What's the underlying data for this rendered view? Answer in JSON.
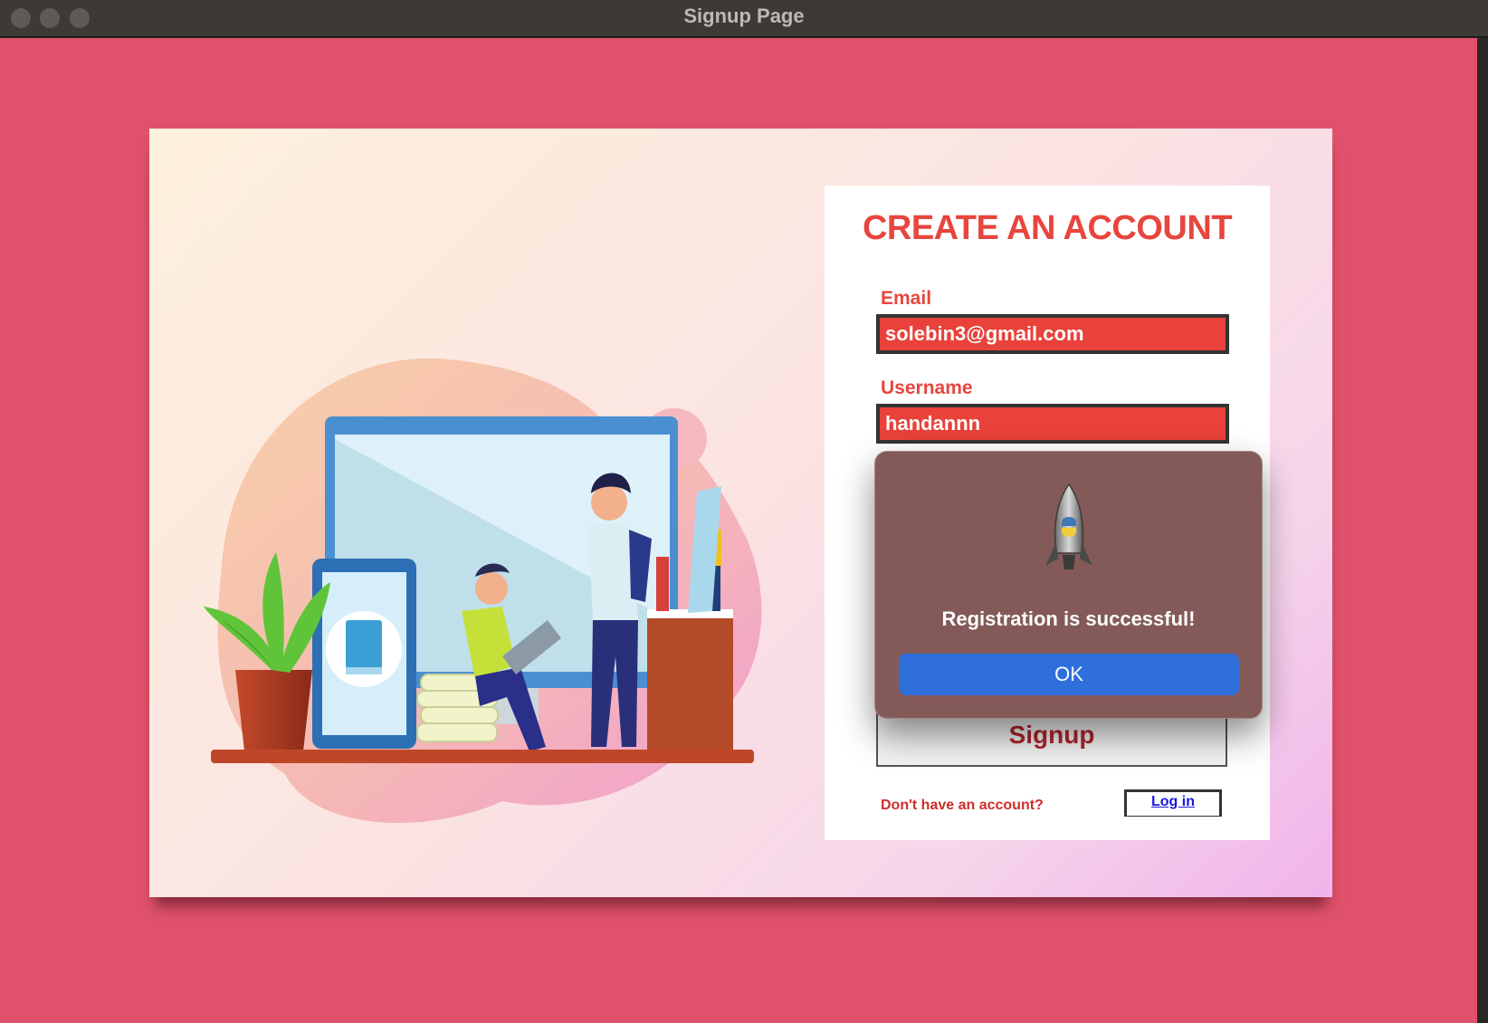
{
  "window": {
    "title": "Signup Page"
  },
  "form": {
    "heading": "CREATE AN ACCOUNT",
    "email_label": "Email",
    "email_value": "solebin3@gmail.com",
    "username_label": "Username",
    "username_value": "handannn",
    "signup_label": "Signup",
    "no_account_text": "Don't have an account?",
    "login_label": "Log in"
  },
  "dialog": {
    "message": "Registration is successful!",
    "ok_label": "OK",
    "icon": "python-rocket-icon"
  },
  "colors": {
    "background": "#e0526b",
    "accent_red": "#e8453e",
    "ok_blue": "#2f6fdc",
    "dialog_bg": "#845a58"
  }
}
